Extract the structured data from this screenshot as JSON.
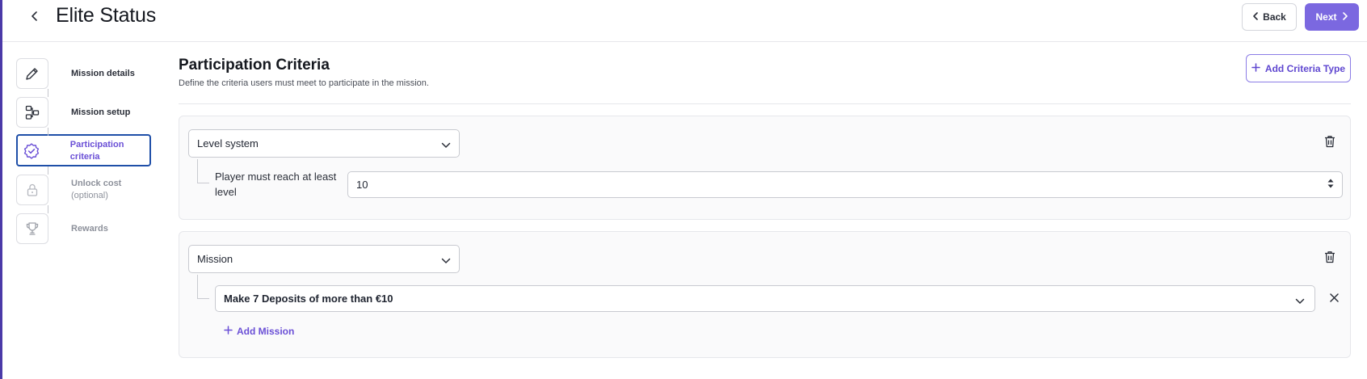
{
  "header": {
    "title": "Elite Status",
    "back_label": "Back",
    "next_label": "Next"
  },
  "stepper": {
    "steps": [
      {
        "label": "Mission details",
        "icon": "pencil-icon",
        "state": "complete"
      },
      {
        "label": "Mission setup",
        "icon": "workflow-icon",
        "state": "complete"
      },
      {
        "label": "Participation criteria",
        "icon": "badge-check-icon",
        "state": "active"
      },
      {
        "label": "Unlock cost",
        "sublabel": "(optional)",
        "icon": "lock-icon",
        "state": "disabled"
      },
      {
        "label": "Rewards",
        "icon": "trophy-icon",
        "state": "disabled"
      }
    ]
  },
  "main": {
    "title": "Participation Criteria",
    "description": "Define the criteria users must meet to participate in the mission.",
    "add_criteria_label": "Add Criteria Type",
    "criteria": [
      {
        "type": "Level system",
        "condition_label": "Player must reach at least level",
        "value": "10"
      },
      {
        "type": "Mission",
        "missions": [
          "Make 7 Deposits of more than €10"
        ],
        "add_mission_label": "Add Mission"
      }
    ]
  },
  "colors": {
    "accent": "#7b68e0",
    "accent_text": "#5f47d0",
    "active_step_border": "#1f4fa8",
    "sidebar_edge": "#4b3aa8"
  }
}
